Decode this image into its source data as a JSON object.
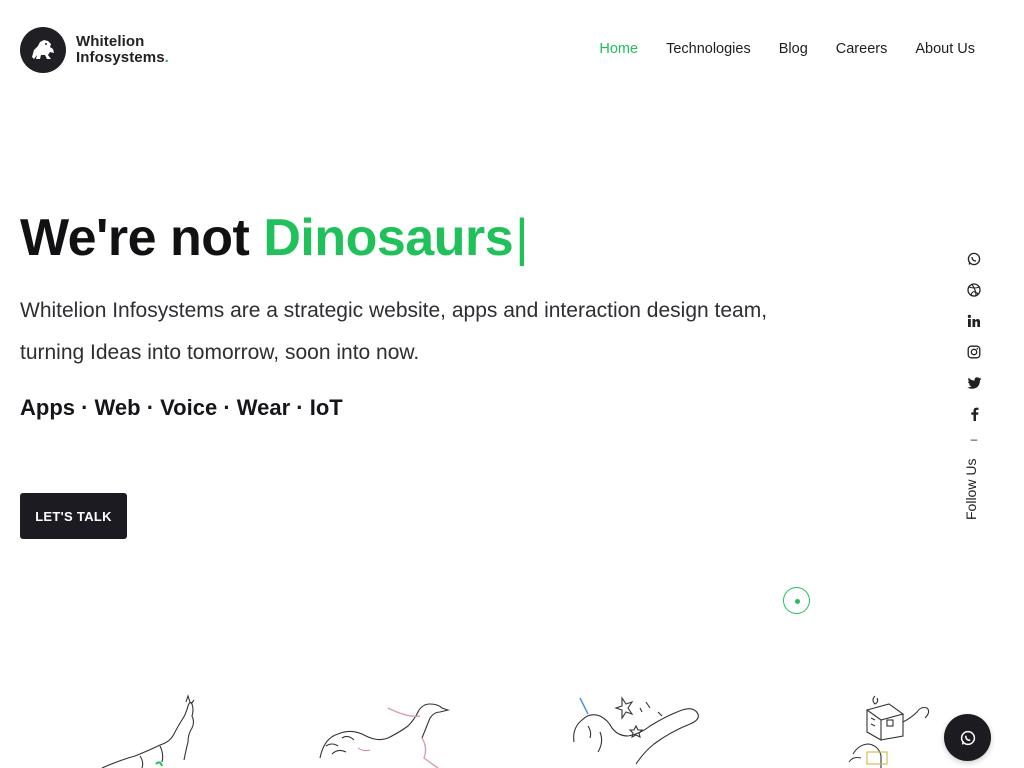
{
  "brand": {
    "name_line1": "Whitelion",
    "name_line2": "Infosystems",
    "name_dot": ".",
    "accent_color": "#20c15a",
    "dark_color": "#1c1b22"
  },
  "nav": {
    "items": [
      {
        "label": "Home",
        "active": true
      },
      {
        "label": "Technologies",
        "active": false
      },
      {
        "label": "Blog",
        "active": false
      },
      {
        "label": "Careers",
        "active": false
      },
      {
        "label": "About Us",
        "active": false
      }
    ]
  },
  "hero": {
    "title_prefix": "We're not ",
    "title_accent": "Dinosaurs",
    "title_cursor": "|",
    "description_line1": "Whitelion Infosystems are a strategic website, apps and interaction design team,",
    "description_line2": "turning Ideas into tomorrow, soon into now.",
    "tags": "Apps · Web · Voice · Wear · IoT",
    "cta_label": "LET'S TALK"
  },
  "social": {
    "icons": [
      "whatsapp-icon",
      "dribbble-icon",
      "linkedin-icon",
      "instagram-icon",
      "twitter-icon",
      "facebook-icon"
    ],
    "dash": "–",
    "follow_label": "Follow Us"
  },
  "illustrations": [
    "wolf-illustration",
    "ostrich-illustration",
    "unicorn-illustration",
    "robot-illustration"
  ],
  "chat": {
    "icon": "whatsapp-icon"
  }
}
